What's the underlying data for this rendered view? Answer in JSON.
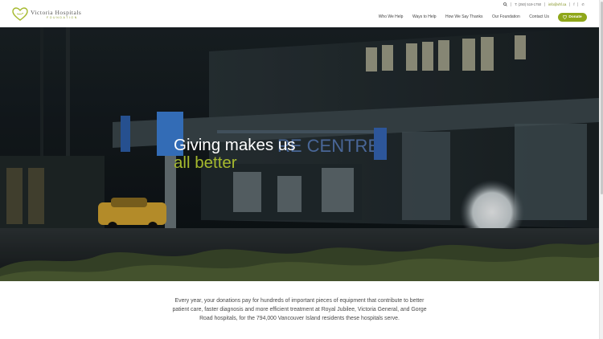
{
  "brand": {
    "name": "Victoria Hospitals",
    "sub": "FOUNDATION"
  },
  "utility": {
    "search_icon": "search-icon",
    "phone": "T: (250) 519-1750",
    "email": "info@vhf.ca",
    "social_1": "f",
    "social_2": "✆"
  },
  "nav": {
    "items": [
      {
        "label": "Who We Help"
      },
      {
        "label": "Ways to Help"
      },
      {
        "label": "How We Say Thanks"
      },
      {
        "label": "Our Foundation"
      },
      {
        "label": "Contact Us"
      }
    ],
    "donate_label": "Donate",
    "donate_icon": "heart-icon"
  },
  "hero": {
    "line1": "Giving makes us",
    "line2": "all better",
    "sign_text": "RE CENTRE",
    "accent_color": "#a6b92e"
  },
  "intro": {
    "text": "Every year, your donations pay for hundreds of important pieces of equipment that contribute to better patient care, faster diagnosis and more efficient treatment at Royal Jubilee, Victoria General, and Gorge Road hospitals, for the 794,000 Vancouver Island residents these hospitals serve."
  },
  "colors": {
    "brand_green": "#8fa71a",
    "text": "#4a4a4a"
  }
}
